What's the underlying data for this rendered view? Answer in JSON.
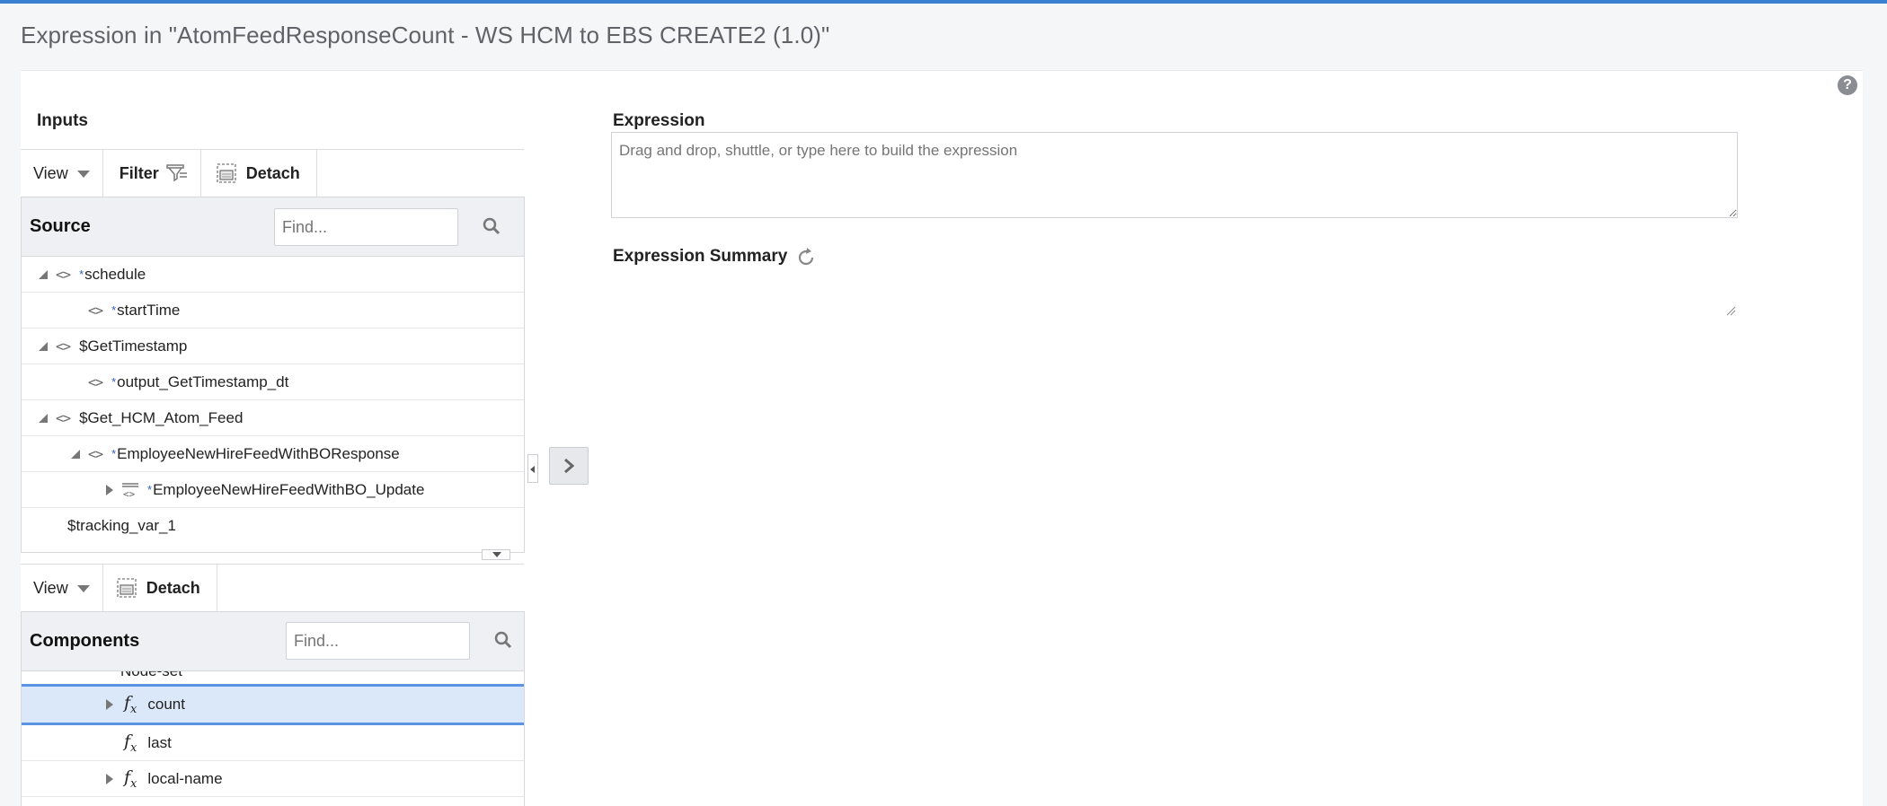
{
  "header": {
    "title": "Expression in \"AtomFeedResponseCount - WS HCM to EBS CREATE2 (1.0)\""
  },
  "inputs": {
    "section_label": "Inputs",
    "toolbar": {
      "view_label": "View",
      "filter_label": "Filter",
      "detach_label": "Detach"
    },
    "source": {
      "header": "Source",
      "find_placeholder": "Find...",
      "rows": [
        {
          "label": "schedule",
          "required": true
        },
        {
          "label": "startTime",
          "required": true
        },
        {
          "label": "$GetTimestamp",
          "required": false
        },
        {
          "label": "output_GetTimestamp_dt",
          "required": true
        },
        {
          "label": "$Get_HCM_Atom_Feed",
          "required": false
        },
        {
          "label": "EmployeeNewHireFeedWithBOResponse",
          "required": true
        },
        {
          "label": "EmployeeNewHireFeedWithBO_Update",
          "required": true
        },
        {
          "label": "$tracking_var_1",
          "required": false
        }
      ]
    }
  },
  "components": {
    "toolbar": {
      "view_label": "View",
      "detach_label": "Detach"
    },
    "header": "Components",
    "find_placeholder": "Find...",
    "partial_row": "Node-set",
    "rows": [
      {
        "label": "count",
        "selected": true
      },
      {
        "label": "last",
        "selected": false
      },
      {
        "label": "local-name",
        "selected": false
      }
    ]
  },
  "expression": {
    "label": "Expression",
    "placeholder": "Drag and drop, shuttle, or type here to build the expression",
    "summary_label": "Expression Summary"
  },
  "help": {
    "glyph": "?"
  },
  "icons": {
    "element": "code-brackets-icon",
    "function": "fx-icon",
    "filter": "filter-icon",
    "detach": "detach-icon",
    "search": "search-icon",
    "refresh": "refresh-icon"
  },
  "colors": {
    "accent": "#3a7fd0",
    "selection": "#dbe8f9",
    "required_star": "#2a62b8"
  }
}
